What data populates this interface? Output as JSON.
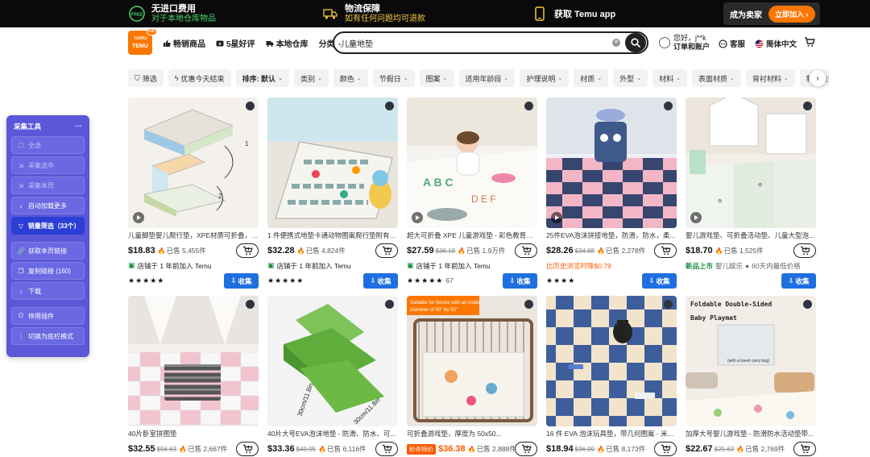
{
  "banner": {
    "free_badge": "FREE",
    "seg1_title": "无进口费用",
    "seg1_sub": "对于本地仓库物品",
    "seg2_title": "物流保障",
    "seg2_sub": "如有任何问题均可退款",
    "seg3_title": "获取 Temu app",
    "seller_label": "成为卖家",
    "seller_button": "立即加入 ›"
  },
  "header": {
    "logo_top": "TEMU",
    "logo_text": "TEMU",
    "logo_badge": "US",
    "nav": [
      "畅销商品",
      "5星好评",
      "本地仓库",
      "分类"
    ],
    "search_value": "儿童地垫",
    "account_line1": "您好，j**k",
    "account_line2": "订单和账户",
    "service": "客服",
    "language": "简体中文"
  },
  "filters": {
    "chips": [
      "筛选",
      "优惠今天结束",
      "排序: 默认",
      "类别",
      "颜色",
      "节假日",
      "图案",
      "适用年龄段",
      "护理说明",
      "材质",
      "外型",
      "材料",
      "表面材质",
      "背衬材料",
      "制造类型",
      "颜家"
    ]
  },
  "panel": {
    "title": "采集工具",
    "more": "···",
    "buttons": [
      {
        "icon": "☐",
        "label": "全选",
        "state": "dim"
      },
      {
        "icon": "⇲",
        "label": "采集选中",
        "state": "dim"
      },
      {
        "icon": "⇲",
        "label": "采集本页",
        "state": "dim"
      },
      {
        "icon": "↓",
        "label": "自动加载更多",
        "state": "normal"
      },
      {
        "icon": "▽",
        "label": "销量筛选（33个）",
        "state": "active"
      },
      {
        "icon": "🔗",
        "label": "获取本页链接",
        "state": "normal"
      },
      {
        "icon": "❐",
        "label": "复制链接 (160)",
        "state": "normal"
      },
      {
        "icon": "↓",
        "label": "下载",
        "state": "normal"
      },
      {
        "icon": "⏻",
        "label": "停用插件",
        "state": "normal"
      },
      {
        "icon": "⋮",
        "label": "切换为底栏模式",
        "state": "normal"
      }
    ]
  },
  "products": [
    {
      "title": "儿童脚垫婴儿爬行垫，XPE材质可折叠，防...",
      "price": "$18.83",
      "old": "",
      "sold": "已售 5,455件",
      "line3": "店铺于 1 年前加入 Temu",
      "line3_type": "shop",
      "stars": "★★★★★",
      "rating_count": "",
      "collect": "收集",
      "video": true
    },
    {
      "title": "1 件便携式地垫卡通动物图案爬行垫附有手...",
      "price": "$32.28",
      "old": "",
      "sold": "已售 4,824件",
      "line3": "店铺于 1 年前加入 Temu",
      "line3_type": "shop",
      "stars": "★★★★★",
      "rating_count": "",
      "collect": "收集",
      "video": false
    },
    {
      "title": "超大可折叠 XPE 儿童游戏垫 - 彩色教育动...",
      "price": "$27.59",
      "old": "$36.18",
      "sold": "已售 1.9万件",
      "line3": "店铺于 1 年前加入 Temu",
      "line3_type": "shop",
      "stars": "★★★★★",
      "rating_count": "67",
      "collect": "收集",
      "video": true
    },
    {
      "title": "25件EVA泡沫拼接地垫，防滑，防水，柔...",
      "price": "$28.26",
      "old": "$34.88",
      "sold": "已售 2,278件",
      "line3": "比历史浏览时降$0.79",
      "line3_type": "orange",
      "stars": "★★★★",
      "rating_count": "",
      "collect": "收集",
      "video": true
    },
    {
      "title": "婴儿游戏垫、可折叠活动垫、儿童大型泡...",
      "price": "$18.70",
      "old": "",
      "sold": "已售 1,525件",
      "line3": "婴儿娱乐",
      "line3_prefix": "新品上市",
      "line3_suffix": "60天内最低价格",
      "line3_type": "new",
      "stars": "",
      "rating_count": "",
      "collect": "收集",
      "video": true
    },
    {
      "title": "40片卧室拼图垫",
      "price": "$32.55",
      "old": "$56.63",
      "sold": "已售 2,667件",
      "line3": "",
      "line3_type": "",
      "stars": "",
      "rating_count": "",
      "collect": "",
      "video": false
    },
    {
      "title": "40片大号EVA泡沫地垫 - 防滑、防水、可...",
      "price": "$33.36",
      "old": "$49.95",
      "sold": "已售 6,116件",
      "line3": "",
      "line3_type": "",
      "stars": "",
      "rating_count": "",
      "collect": "",
      "video": false
    },
    {
      "title": "可折叠游戏垫，厚度为 50x50...",
      "price": "$36.38",
      "old": "",
      "sold": "已售 2,888件",
      "badge": "秒杀特价",
      "line3": "",
      "line3_type": "",
      "stars": "",
      "rating_count": "",
      "collect": "",
      "video": false
    },
    {
      "title": "16 件 EVA 泡沫玩具垫，带几何图案 - 米色...",
      "price": "$18.94",
      "old": "$36.09",
      "sold": "已售 8,173件",
      "line3": "",
      "line3_type": "",
      "stars": "",
      "rating_count": "",
      "collect": "",
      "video": false
    },
    {
      "title": "加厚大号婴儿游戏垫 - 防滑防水活动垫带...",
      "price": "$22.67",
      "old": "$25.63",
      "sold": "已售 2,769件",
      "line3": "",
      "line3_type": "",
      "stars": "",
      "rating_count": "",
      "collect": "",
      "video": false
    }
  ],
  "image_text": {
    "p2_labels": [
      "1",
      "2"
    ],
    "p7_label_a": "30cm/11.8in",
    "p7_label_b": "30cm/11.8in",
    "p8_banner_l1": "Suitable for fences with an inside",
    "p8_banner_l2": "diameter of 50\" by 50\"",
    "p10_title_l1": "Foldable Double-Sided",
    "p10_title_l2": "Baby Playmat",
    "p10_sub": "(with a travel carry bag)"
  }
}
